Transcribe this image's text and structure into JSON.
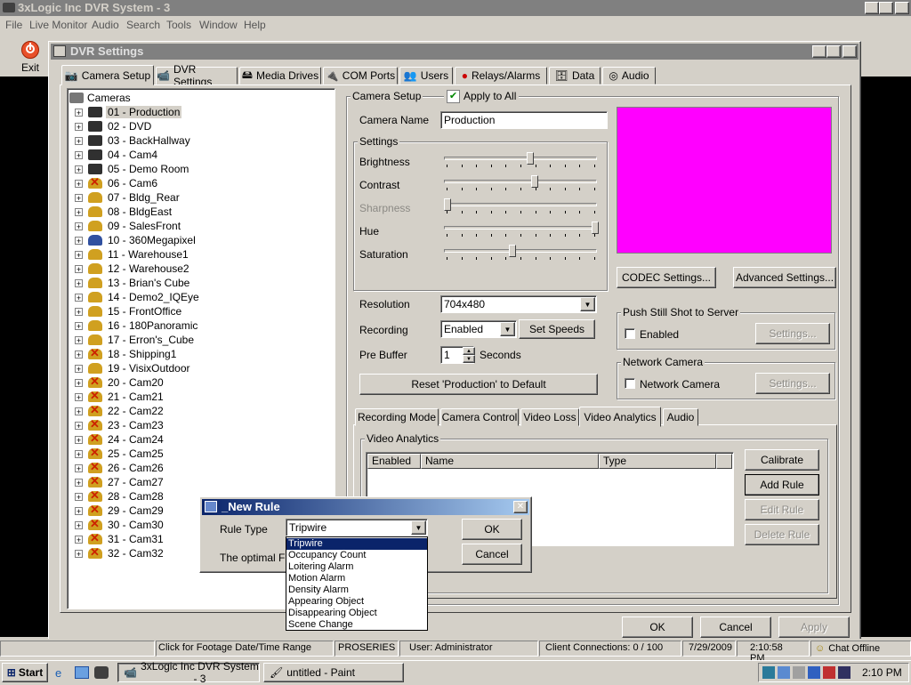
{
  "main_window": {
    "title": "3xLogic Inc DVR System - 3",
    "menu": [
      "File",
      "Live Monitor",
      "Audio",
      "Search",
      "Tools",
      "Window",
      "Help"
    ],
    "exit_label": "Exit"
  },
  "dialog": {
    "title": "DVR Settings",
    "tabs": [
      "Camera Setup",
      "DVR Settings",
      "Media Drives",
      "COM Ports",
      "Users",
      "Relays/Alarms",
      "Data",
      "Audio"
    ],
    "active_tab": "Camera Setup",
    "tree_root": "Cameras",
    "cameras": [
      "01 - Production",
      "02 - DVD",
      "03 - BackHallway",
      "04 - Cam4",
      "05 - Demo Room",
      "06 - Cam6",
      "07 - Bldg_Rear",
      "08 - BldgEast",
      "09 - SalesFront",
      "10 - 360Megapixel",
      "11 - Warehouse1",
      "12 - Warehouse2",
      "13 - Brian's Cube",
      "14 - Demo2_IQEye",
      "15 - FrontOffice",
      "16 - 180Panoramic",
      "17 - Erron's_Cube",
      "18 - Shipping1",
      "19 - VisixOutdoor",
      "20 - Cam20",
      "21 - Cam21",
      "22 - Cam22",
      "23 - Cam23",
      "24 - Cam24",
      "25 - Cam25",
      "26 - Cam26",
      "27 - Cam27",
      "28 - Cam28",
      "29 - Cam29",
      "30 - Cam30",
      "31 - Cam31",
      "32 - Cam32"
    ],
    "camera_setup": {
      "group_label": "Camera Setup",
      "apply_all_label": "Apply to All",
      "camera_name_label": "Camera Name",
      "camera_name_value": "Production",
      "settings_label": "Settings",
      "sliders": [
        {
          "label": "Brightness",
          "value": 0.56,
          "disabled": false
        },
        {
          "label": "Contrast",
          "value": 0.59,
          "disabled": false
        },
        {
          "label": "Sharpness",
          "value": 0.0,
          "disabled": true
        },
        {
          "label": "Hue",
          "value": 1.0,
          "disabled": false
        },
        {
          "label": "Saturation",
          "value": 0.44,
          "disabled": false
        }
      ],
      "resolution_label": "Resolution",
      "resolution_value": "704x480",
      "recording_label": "Recording",
      "recording_value": "Enabled",
      "set_speeds_label": "Set Speeds",
      "prebuffer_label": "Pre Buffer",
      "prebuffer_value": "1",
      "seconds_label": "Seconds",
      "reset_label": "Reset 'Production' to Default",
      "preview_color": "#ff00ff",
      "codec_label": "CODEC Settings...",
      "advanced_label": "Advanced Settings...",
      "push_group": "Push Still Shot to Server",
      "push_enabled_label": "Enabled",
      "push_settings_label": "Settings...",
      "network_group": "Network Camera",
      "network_label": "Network Camera",
      "network_settings_label": "Settings..."
    },
    "subtabs": [
      "Recording Mode",
      "Camera Control",
      "Video Loss",
      "Video Analytics",
      "Audio"
    ],
    "active_subtab": "Video Analytics",
    "analytics": {
      "group_label": "Video Analytics",
      "columns": [
        "Enabled",
        "Name",
        "Type"
      ],
      "calibrate_label": "Calibrate",
      "add_rule_label": "Add Rule",
      "edit_rule_label": "Edit Rule",
      "delete_rule_label": "Delete Rule"
    },
    "ok_label": "OK",
    "cancel_label": "Cancel",
    "apply_label": "Apply"
  },
  "new_rule": {
    "title": "_New Rule",
    "rule_type_label": "Rule Type",
    "rule_type_value": "Tripwire",
    "fps_text": "The optimal FPS",
    "ok_label": "OK",
    "cancel_label": "Cancel",
    "options": [
      "Tripwire",
      "Occupancy Count",
      "Loitering Alarm",
      "Motion Alarm",
      "Density Alarm",
      "Appearing Object",
      "Disappearing Object",
      "Scene Change"
    ],
    "selected_option": "Tripwire"
  },
  "status_bar": {
    "hint": "Click for Footage Date/Time Range",
    "product": "PROSERIES",
    "user": "User: Administrator",
    "connections": "Client Connections: 0 / 100",
    "date": "7/29/2009",
    "time": "2:10:58 PM",
    "chat": "Chat Offline"
  },
  "taskbar": {
    "start_label": "Start",
    "tasks": [
      "3xLogic Inc DVR System - 3",
      "untitled - Paint"
    ],
    "clock": "2:10 PM"
  },
  "colors": {
    "desktop": "#000000",
    "face": "#d4d0c8",
    "selection": "#0a246a",
    "preview": "#ff00ff",
    "disabled_cam": "#cc2200"
  }
}
